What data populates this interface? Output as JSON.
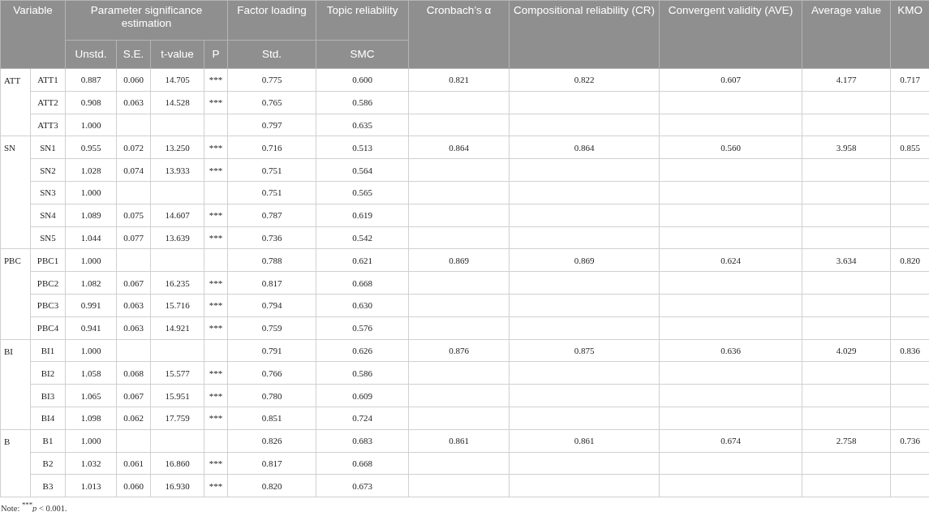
{
  "table": {
    "header_top": [
      "Variable",
      "Parameter significance estimation",
      "Factor loading",
      "Topic reliability",
      "Cronbach’s α",
      "Compositional reliability (CR)",
      "Convergent validity (AVE)",
      "Average value",
      "KMO"
    ],
    "header_sub": [
      "Unstd.",
      "S.E.",
      "t-value",
      "P",
      "Std.",
      "SMC"
    ],
    "groups": [
      {
        "variable": "ATT",
        "cronbach": "0.821",
        "cr": "0.822",
        "ave": "0.607",
        "average": "4.177",
        "kmo": "0.717",
        "items": [
          {
            "item": "ATT1",
            "unstd": "0.887",
            "se": "0.060",
            "t": "14.705",
            "p": "***",
            "std": "0.775",
            "smc": "0.600"
          },
          {
            "item": "ATT2",
            "unstd": "0.908",
            "se": "0.063",
            "t": "14.528",
            "p": "***",
            "std": "0.765",
            "smc": "0.586"
          },
          {
            "item": "ATT3",
            "unstd": "1.000",
            "std": "0.797",
            "smc": "0.635"
          }
        ]
      },
      {
        "variable": "SN",
        "cronbach": "0.864",
        "cr": "0.864",
        "ave": "0.560",
        "average": "3.958",
        "kmo": "0.855",
        "items": [
          {
            "item": "SN1",
            "unstd": "0.955",
            "se": "0.072",
            "t": "13.250",
            "p": "***",
            "std": "0.716",
            "smc": "0.513"
          },
          {
            "item": "SN2",
            "unstd": "1.028",
            "se": "0.074",
            "t": "13.933",
            "p": "***",
            "std": "0.751",
            "smc": "0.564"
          },
          {
            "item": "SN3",
            "unstd": "1.000",
            "std": "0.751",
            "smc": "0.565"
          },
          {
            "item": "SN4",
            "unstd": "1.089",
            "se": "0.075",
            "t": "14.607",
            "p": "***",
            "std": "0.787",
            "smc": "0.619"
          },
          {
            "item": "SN5",
            "unstd": "1.044",
            "se": "0.077",
            "t": "13.639",
            "p": "***",
            "std": "0.736",
            "smc": "0.542"
          }
        ]
      },
      {
        "variable": "PBC",
        "cronbach": "0.869",
        "cr": "0.869",
        "ave": "0.624",
        "average": "3.634",
        "kmo": "0.820",
        "items": [
          {
            "item": "PBC1",
            "unstd": "1.000",
            "std": "0.788",
            "smc": "0.621"
          },
          {
            "item": "PBC2",
            "unstd": "1.082",
            "se": "0.067",
            "t": "16.235",
            "p": "***",
            "std": "0.817",
            "smc": "0.668"
          },
          {
            "item": "PBC3",
            "unstd": "0.991",
            "se": "0.063",
            "t": "15.716",
            "p": "***",
            "std": "0.794",
            "smc": "0.630"
          },
          {
            "item": "PBC4",
            "unstd": "0.941",
            "se": "0.063",
            "t": "14.921",
            "p": "***",
            "std": "0.759",
            "smc": "0.576"
          }
        ]
      },
      {
        "variable": "BI",
        "cronbach": "0.876",
        "cr": "0.875",
        "ave": "0.636",
        "average": "4.029",
        "kmo": "0.836",
        "items": [
          {
            "item": "BI1",
            "unstd": "1.000",
            "std": "0.791",
            "smc": "0.626"
          },
          {
            "item": "BI2",
            "unstd": "1.058",
            "se": "0.068",
            "t": "15.577",
            "p": "***",
            "std": "0.766",
            "smc": "0.586"
          },
          {
            "item": "BI3",
            "unstd": "1.065",
            "se": "0.067",
            "t": "15.951",
            "p": "***",
            "std": "0.780",
            "smc": "0.609"
          },
          {
            "item": "BI4",
            "unstd": "1.098",
            "se": "0.062",
            "t": "17.759",
            "p": "***",
            "std": "0.851",
            "smc": "0.724"
          }
        ]
      },
      {
        "variable": "B",
        "cronbach": "0.861",
        "cr": "0.861",
        "ave": "0.674",
        "average": "2.758",
        "kmo": "0.736",
        "items": [
          {
            "item": "B1",
            "unstd": "1.000",
            "std": "0.826",
            "smc": "0.683"
          },
          {
            "item": "B2",
            "unstd": "1.032",
            "se": "0.061",
            "t": "16.860",
            "p": "***",
            "std": "0.817",
            "smc": "0.668"
          },
          {
            "item": "B3",
            "unstd": "1.013",
            "se": "0.060",
            "t": "16.930",
            "p": "***",
            "std": "0.820",
            "smc": "0.673"
          }
        ]
      }
    ]
  },
  "note": "Note: $^{***}$*p* < 0.001."
}
